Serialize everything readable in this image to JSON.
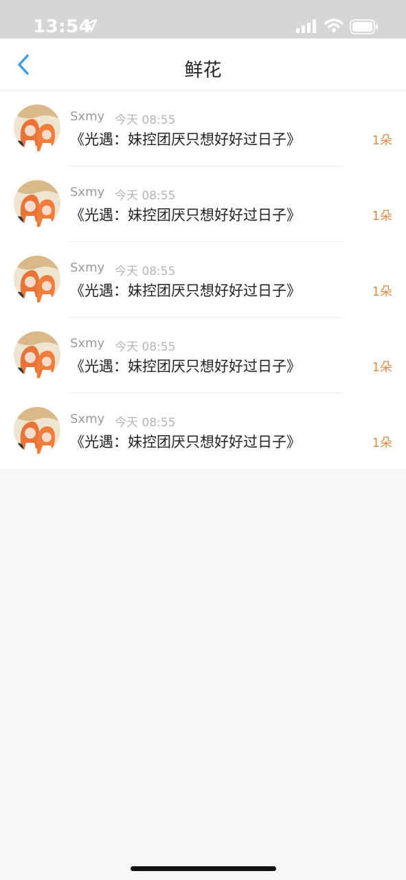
{
  "status_bar": {
    "time": "13:54",
    "icons": [
      "location-arrow-icon",
      "signal-icon",
      "wifi-icon",
      "battery-icon"
    ]
  },
  "nav": {
    "title": "鲜花",
    "back_icon": "chevron-left-icon",
    "accent_color": "#3a9ee8"
  },
  "list": {
    "items": [
      {
        "user": "Sxmy",
        "time": "今天 08:55",
        "title": "《光遇：妹控团厌只想好好过日子》",
        "count": "1朵"
      },
      {
        "user": "Sxmy",
        "time": "今天 08:55",
        "title": "《光遇：妹控团厌只想好好过日子》",
        "count": "1朵"
      },
      {
        "user": "Sxmy",
        "time": "今天 08:55",
        "title": "《光遇：妹控团厌只想好好过日子》",
        "count": "1朵"
      },
      {
        "user": "Sxmy",
        "time": "今天 08:55",
        "title": "《光遇：妹控团厌只想好好过日子》",
        "count": "1朵"
      },
      {
        "user": "Sxmy",
        "time": "今天 08:55",
        "title": "《光遇：妹控团厌只想好好过日子》",
        "count": "1朵"
      }
    ]
  },
  "colors": {
    "count_color": "#e58a44",
    "background": "#f7f7f7"
  }
}
